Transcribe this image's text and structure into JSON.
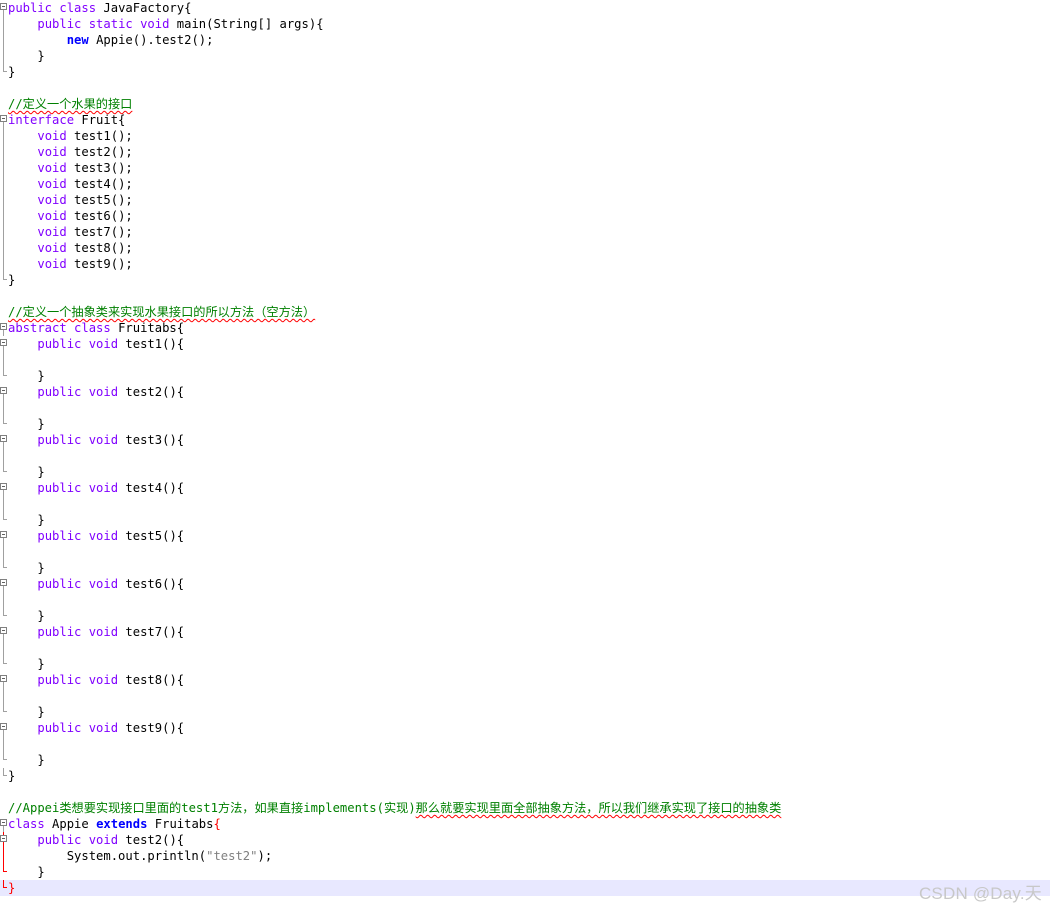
{
  "editor": {
    "lines": [
      {
        "fold": "box",
        "parts": [
          {
            "c": "kw",
            "t": "public class "
          },
          {
            "c": "plain",
            "t": "JavaFactory{"
          }
        ]
      },
      {
        "fold": "line",
        "parts": [
          {
            "c": "plain",
            "t": "    "
          },
          {
            "c": "kw",
            "t": "public static void "
          },
          {
            "c": "plain",
            "t": "main(String[] args){"
          }
        ]
      },
      {
        "fold": "line",
        "parts": [
          {
            "c": "plain",
            "t": "        "
          },
          {
            "c": "kwb",
            "t": "new "
          },
          {
            "c": "plain",
            "t": "Appie().test2();"
          }
        ]
      },
      {
        "fold": "line",
        "parts": [
          {
            "c": "plain",
            "t": "    }"
          }
        ]
      },
      {
        "fold": "end",
        "parts": [
          {
            "c": "plain",
            "t": "}"
          }
        ]
      },
      {
        "fold": "",
        "parts": []
      },
      {
        "fold": "",
        "parts": [
          {
            "c": "cmt",
            "t": "//定义一个水果的接口"
          }
        ]
      },
      {
        "fold": "box",
        "parts": [
          {
            "c": "kw",
            "t": "interface "
          },
          {
            "c": "plain",
            "t": "Fruit{"
          }
        ]
      },
      {
        "fold": "line",
        "parts": [
          {
            "c": "plain",
            "t": "    "
          },
          {
            "c": "kw",
            "t": "void "
          },
          {
            "c": "plain",
            "t": "test1();"
          }
        ]
      },
      {
        "fold": "line",
        "parts": [
          {
            "c": "plain",
            "t": "    "
          },
          {
            "c": "kw",
            "t": "void "
          },
          {
            "c": "plain",
            "t": "test2();"
          }
        ]
      },
      {
        "fold": "line",
        "parts": [
          {
            "c": "plain",
            "t": "    "
          },
          {
            "c": "kw",
            "t": "void "
          },
          {
            "c": "plain",
            "t": "test3();"
          }
        ]
      },
      {
        "fold": "line",
        "parts": [
          {
            "c": "plain",
            "t": "    "
          },
          {
            "c": "kw",
            "t": "void "
          },
          {
            "c": "plain",
            "t": "test4();"
          }
        ]
      },
      {
        "fold": "line",
        "parts": [
          {
            "c": "plain",
            "t": "    "
          },
          {
            "c": "kw",
            "t": "void "
          },
          {
            "c": "plain",
            "t": "test5();"
          }
        ]
      },
      {
        "fold": "line",
        "parts": [
          {
            "c": "plain",
            "t": "    "
          },
          {
            "c": "kw",
            "t": "void "
          },
          {
            "c": "plain",
            "t": "test6();"
          }
        ]
      },
      {
        "fold": "line",
        "parts": [
          {
            "c": "plain",
            "t": "    "
          },
          {
            "c": "kw",
            "t": "void "
          },
          {
            "c": "plain",
            "t": "test7();"
          }
        ]
      },
      {
        "fold": "line",
        "parts": [
          {
            "c": "plain",
            "t": "    "
          },
          {
            "c": "kw",
            "t": "void "
          },
          {
            "c": "plain",
            "t": "test8();"
          }
        ]
      },
      {
        "fold": "line",
        "parts": [
          {
            "c": "plain",
            "t": "    "
          },
          {
            "c": "kw",
            "t": "void "
          },
          {
            "c": "plain",
            "t": "test9();"
          }
        ]
      },
      {
        "fold": "end",
        "parts": [
          {
            "c": "plain",
            "t": "}"
          }
        ]
      },
      {
        "fold": "",
        "parts": []
      },
      {
        "fold": "",
        "parts": [
          {
            "c": "cmt",
            "t": "//定义一个抽象类来实现水果接口的所以方法（空方法）"
          }
        ]
      },
      {
        "fold": "box",
        "parts": [
          {
            "c": "kw",
            "t": "abstract class "
          },
          {
            "c": "plain",
            "t": "Fruitabs{"
          }
        ]
      },
      {
        "fold": "box",
        "parts": [
          {
            "c": "plain",
            "t": "    "
          },
          {
            "c": "kw",
            "t": "public void "
          },
          {
            "c": "plain",
            "t": "test1(){"
          }
        ]
      },
      {
        "fold": "line",
        "parts": []
      },
      {
        "fold": "end",
        "parts": [
          {
            "c": "plain",
            "t": "    }"
          }
        ]
      },
      {
        "fold": "box",
        "parts": [
          {
            "c": "plain",
            "t": "    "
          },
          {
            "c": "kw",
            "t": "public void "
          },
          {
            "c": "plain",
            "t": "test2(){"
          }
        ]
      },
      {
        "fold": "line",
        "parts": []
      },
      {
        "fold": "end",
        "parts": [
          {
            "c": "plain",
            "t": "    }"
          }
        ]
      },
      {
        "fold": "box",
        "parts": [
          {
            "c": "plain",
            "t": "    "
          },
          {
            "c": "kw",
            "t": "public void "
          },
          {
            "c": "plain",
            "t": "test3(){"
          }
        ]
      },
      {
        "fold": "line",
        "parts": []
      },
      {
        "fold": "end",
        "parts": [
          {
            "c": "plain",
            "t": "    }"
          }
        ]
      },
      {
        "fold": "box",
        "parts": [
          {
            "c": "plain",
            "t": "    "
          },
          {
            "c": "kw",
            "t": "public void "
          },
          {
            "c": "plain",
            "t": "test4(){"
          }
        ]
      },
      {
        "fold": "line",
        "parts": []
      },
      {
        "fold": "end",
        "parts": [
          {
            "c": "plain",
            "t": "    }"
          }
        ]
      },
      {
        "fold": "box",
        "parts": [
          {
            "c": "plain",
            "t": "    "
          },
          {
            "c": "kw",
            "t": "public void "
          },
          {
            "c": "plain",
            "t": "test5(){"
          }
        ]
      },
      {
        "fold": "line",
        "parts": []
      },
      {
        "fold": "end",
        "parts": [
          {
            "c": "plain",
            "t": "    }"
          }
        ]
      },
      {
        "fold": "box",
        "parts": [
          {
            "c": "plain",
            "t": "    "
          },
          {
            "c": "kw",
            "t": "public void "
          },
          {
            "c": "plain",
            "t": "test6(){"
          }
        ]
      },
      {
        "fold": "line",
        "parts": []
      },
      {
        "fold": "end",
        "parts": [
          {
            "c": "plain",
            "t": "    }"
          }
        ]
      },
      {
        "fold": "box",
        "parts": [
          {
            "c": "plain",
            "t": "    "
          },
          {
            "c": "kw",
            "t": "public void "
          },
          {
            "c": "plain",
            "t": "test7(){"
          }
        ]
      },
      {
        "fold": "line",
        "parts": []
      },
      {
        "fold": "end",
        "parts": [
          {
            "c": "plain",
            "t": "    }"
          }
        ]
      },
      {
        "fold": "box",
        "parts": [
          {
            "c": "plain",
            "t": "    "
          },
          {
            "c": "kw",
            "t": "public void "
          },
          {
            "c": "plain",
            "t": "test8(){"
          }
        ]
      },
      {
        "fold": "line",
        "parts": []
      },
      {
        "fold": "end",
        "parts": [
          {
            "c": "plain",
            "t": "    }"
          }
        ]
      },
      {
        "fold": "box",
        "parts": [
          {
            "c": "plain",
            "t": "    "
          },
          {
            "c": "kw",
            "t": "public void "
          },
          {
            "c": "plain",
            "t": "test9(){"
          }
        ]
      },
      {
        "fold": "line",
        "parts": []
      },
      {
        "fold": "end",
        "parts": [
          {
            "c": "plain",
            "t": "    }"
          }
        ]
      },
      {
        "fold": "end",
        "parts": [
          {
            "c": "plain",
            "t": "}"
          }
        ]
      },
      {
        "fold": "",
        "parts": []
      },
      {
        "fold": "",
        "parts": [
          {
            "c": "cmt-plain",
            "t": "//Appei类想要实现接口里面的test1方法，如果直接implements(实现)"
          },
          {
            "c": "cmt",
            "t": "那么就要实现里面全部抽象方法，所以我们继承实现了接口的抽象类"
          }
        ]
      },
      {
        "fold": "box",
        "parts": [
          {
            "c": "kw",
            "t": "class "
          },
          {
            "c": "plain",
            "t": "Appie "
          },
          {
            "c": "kwb",
            "t": "extends "
          },
          {
            "c": "plain",
            "t": "Fruitabs"
          },
          {
            "c": "red-brace",
            "t": "{"
          }
        ]
      },
      {
        "fold": "redbox",
        "parts": [
          {
            "c": "plain",
            "t": "    "
          },
          {
            "c": "kw",
            "t": "public void "
          },
          {
            "c": "plain",
            "t": "test2(){"
          }
        ]
      },
      {
        "fold": "redline",
        "parts": [
          {
            "c": "plain",
            "t": "        System.out.println("
          },
          {
            "c": "str",
            "t": "\"test2\""
          },
          {
            "c": "plain",
            "t": ");"
          }
        ]
      },
      {
        "fold": "redend",
        "parts": [
          {
            "c": "plain",
            "t": "    }"
          }
        ]
      },
      {
        "fold": "redend",
        "current": true,
        "parts": [
          {
            "c": "red-brace",
            "t": "}"
          }
        ]
      }
    ]
  },
  "watermark": "CSDN @Day.天"
}
